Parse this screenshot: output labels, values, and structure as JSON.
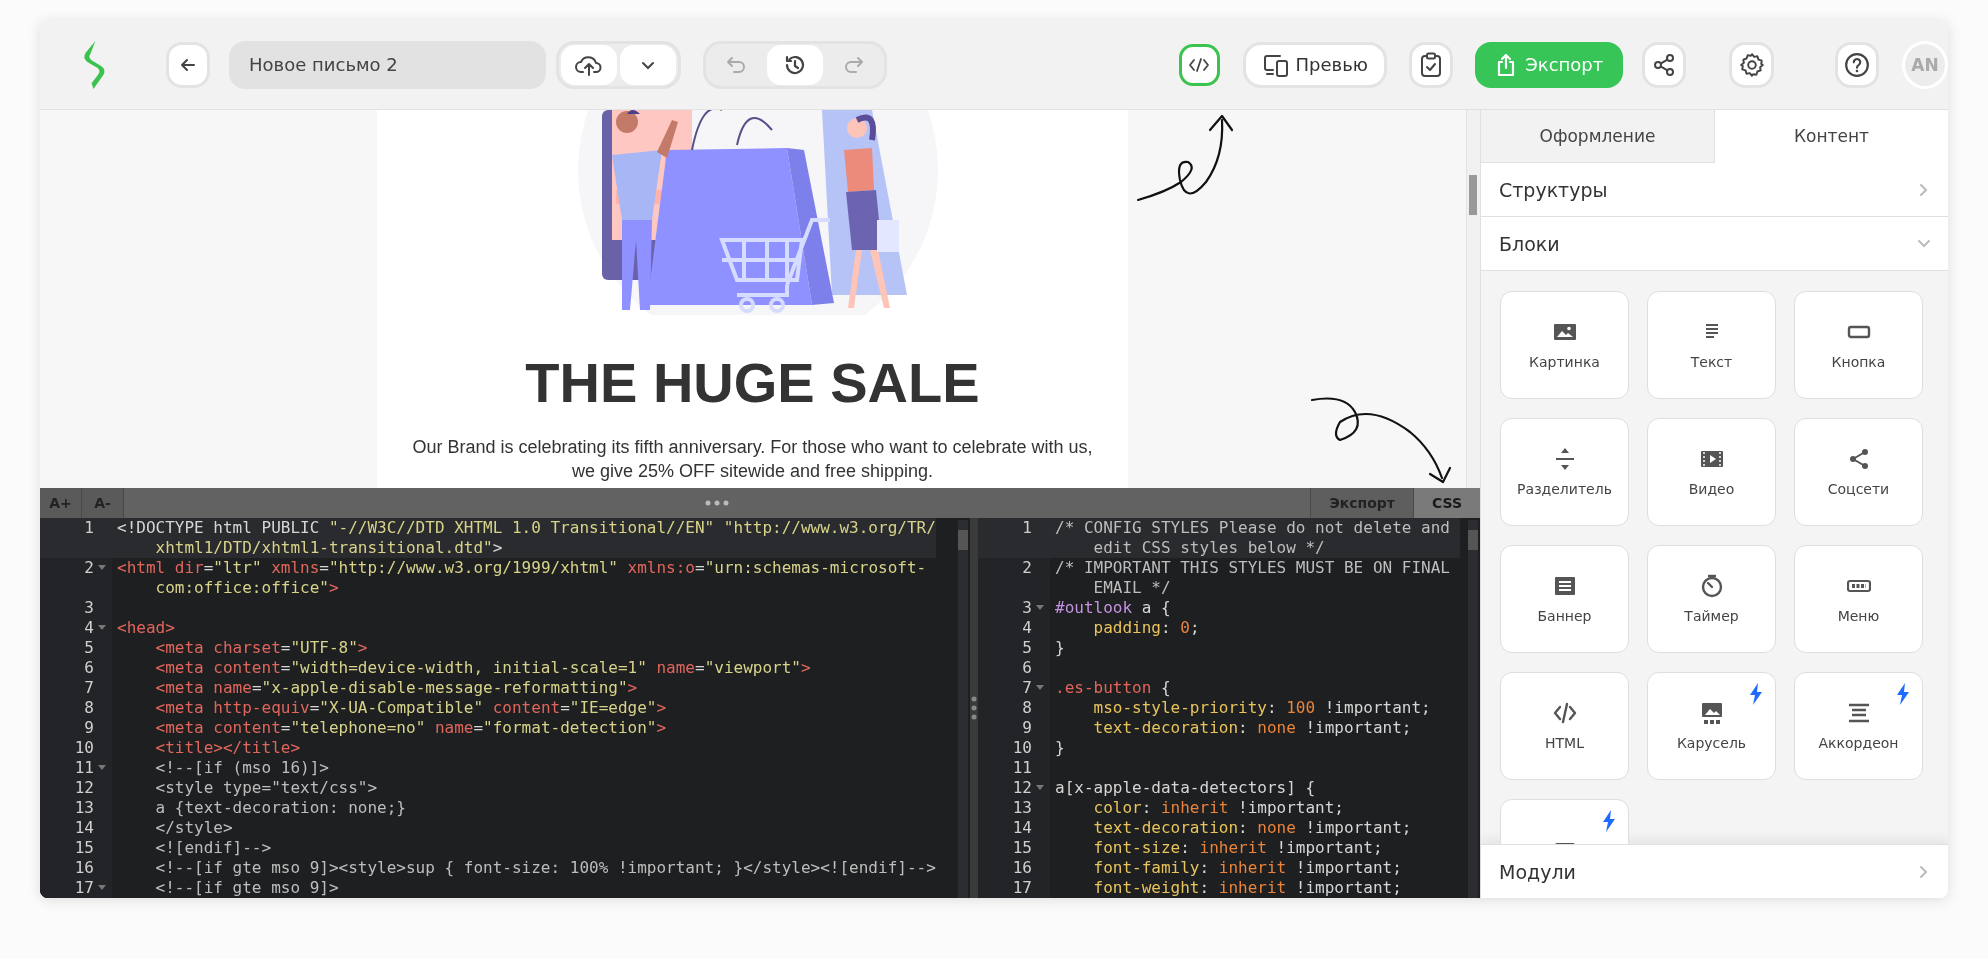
{
  "toolbar": {
    "title": "Новое письмо 2",
    "undo": {
      "disabled": true
    },
    "redo": {
      "disabled": true
    },
    "code_view": {
      "selected": true
    },
    "preview": "Превью",
    "export": "Экспорт",
    "avatar": "AN"
  },
  "canvas": {
    "heading": "THE HUGE SALE",
    "body": "Our Brand is celebrating its fifth anniversary. For those who want to celebrate with us, we give 25% OFF sitewide and free shipping."
  },
  "code_editor": {
    "font_buttons": [
      "A+",
      "A-"
    ],
    "tabs": [
      {
        "label": "Экспорт",
        "selected": false
      },
      {
        "label": "CSS",
        "selected": true
      }
    ],
    "html_lines": [
      {
        "n": "1",
        "fold": false,
        "active": true,
        "tokens": [
          {
            "kind": "plain",
            "t": "<!DOCTYPE html PUBLIC "
          },
          {
            "kind": "string",
            "t": "\"-//W3C//DTD XHTML 1.0 Transitional//EN\""
          },
          {
            "kind": "string",
            "t": " \"http://www.w3.org/TR/xhtml1/DTD/xhtml1-transitional.dtd\""
          },
          {
            "kind": "plain",
            "t": ">"
          }
        ]
      },
      {
        "n": "2",
        "fold": true,
        "active": false,
        "tokens": [
          {
            "kind": "tag",
            "t": "<html"
          },
          {
            "kind": "attr",
            "t": " dir"
          },
          {
            "kind": "plain",
            "t": "="
          },
          {
            "kind": "string",
            "t": "\"ltr\""
          },
          {
            "kind": "attr",
            "t": " xmlns"
          },
          {
            "kind": "plain",
            "t": "="
          },
          {
            "kind": "string",
            "t": "\"http://www.w3.org/1999/xhtml\""
          },
          {
            "kind": "attr",
            "t": " xmlns:o"
          },
          {
            "kind": "plain",
            "t": "="
          },
          {
            "kind": "string",
            "t": "\"urn:schemas-microsoft-com:office:office\""
          },
          {
            "kind": "tag",
            "t": ">"
          }
        ]
      },
      {
        "n": "3",
        "fold": false,
        "active": false
      },
      {
        "n": "4",
        "fold": true,
        "active": false,
        "tokens": [
          {
            "kind": "tag",
            "t": "<head>"
          }
        ]
      },
      {
        "n": "5",
        "fold": false,
        "active": false,
        "tokens": [
          {
            "kind": "tag",
            "t": "    <meta"
          },
          {
            "kind": "attr",
            "t": " charset"
          },
          {
            "kind": "plain",
            "t": "="
          },
          {
            "kind": "string",
            "t": "\"UTF-8\""
          },
          {
            "kind": "tag",
            "t": ">"
          }
        ]
      },
      {
        "n": "6",
        "fold": false,
        "active": false,
        "tokens": [
          {
            "kind": "tag",
            "t": "    <meta"
          },
          {
            "kind": "attr",
            "t": " content"
          },
          {
            "kind": "plain",
            "t": "="
          },
          {
            "kind": "string",
            "t": "\"width=device-width, initial-scale=1\""
          },
          {
            "kind": "attr",
            "t": " name"
          },
          {
            "kind": "plain",
            "t": "="
          },
          {
            "kind": "string",
            "t": "\"viewport\""
          },
          {
            "kind": "tag",
            "t": ">"
          }
        ]
      },
      {
        "n": "7",
        "fold": false,
        "active": false,
        "tokens": [
          {
            "kind": "tag",
            "t": "    <meta"
          },
          {
            "kind": "attr",
            "t": " name"
          },
          {
            "kind": "plain",
            "t": "="
          },
          {
            "kind": "string",
            "t": "\"x-apple-disable-message-reformatting\""
          },
          {
            "kind": "tag",
            "t": ">"
          }
        ]
      },
      {
        "n": "8",
        "fold": false,
        "active": false,
        "tokens": [
          {
            "kind": "tag",
            "t": "    <meta"
          },
          {
            "kind": "attr",
            "t": " http-equiv"
          },
          {
            "kind": "plain",
            "t": "="
          },
          {
            "kind": "string",
            "t": "\"X-UA-Compatible\""
          },
          {
            "kind": "attr",
            "t": " content"
          },
          {
            "kind": "plain",
            "t": "="
          },
          {
            "kind": "string",
            "t": "\"IE=edge\""
          },
          {
            "kind": "tag",
            "t": ">"
          }
        ]
      },
      {
        "n": "9",
        "fold": false,
        "active": false,
        "tokens": [
          {
            "kind": "tag",
            "t": "    <meta"
          },
          {
            "kind": "attr",
            "t": " content"
          },
          {
            "kind": "plain",
            "t": "="
          },
          {
            "kind": "string",
            "t": "\"telephone=no\""
          },
          {
            "kind": "attr",
            "t": " name"
          },
          {
            "kind": "plain",
            "t": "="
          },
          {
            "kind": "string",
            "t": "\"format-detection\""
          },
          {
            "kind": "tag",
            "t": ">"
          }
        ]
      },
      {
        "n": "10",
        "fold": false,
        "active": false,
        "tokens": [
          {
            "kind": "tag",
            "t": "    <title></title>"
          }
        ]
      },
      {
        "n": "11",
        "fold": true,
        "active": false,
        "tokens": [
          {
            "kind": "comment",
            "t": "    <!--[if (mso 16)]>"
          }
        ]
      },
      {
        "n": "12",
        "fold": false,
        "active": false,
        "tokens": [
          {
            "kind": "comment",
            "t": "    <style type=\"text/css\">"
          }
        ]
      },
      {
        "n": "13",
        "fold": false,
        "active": false,
        "tokens": [
          {
            "kind": "comment",
            "t": "    a {text-decoration: none;}"
          }
        ]
      },
      {
        "n": "14",
        "fold": false,
        "active": false,
        "tokens": [
          {
            "kind": "comment",
            "t": "    </style>"
          }
        ]
      },
      {
        "n": "15",
        "fold": false,
        "active": false,
        "tokens": [
          {
            "kind": "comment",
            "t": "    <![endif]-->"
          }
        ]
      },
      {
        "n": "16",
        "fold": false,
        "active": false,
        "tokens": [
          {
            "kind": "comment",
            "t": "    <!--[if gte mso 9]><style>sup { font-size: 100% !important; }</style><![endif]-->"
          }
        ]
      },
      {
        "n": "17",
        "fold": true,
        "active": false,
        "tokens": [
          {
            "kind": "comment",
            "t": "    <!--[if gte mso 9]>"
          }
        ]
      }
    ],
    "css_lines": [
      {
        "n": "1",
        "fold": false,
        "active": true,
        "tokens": [
          {
            "kind": "comment",
            "t": "/* CONFIG STYLES Please do not delete and edit CSS styles below */"
          }
        ]
      },
      {
        "n": "2",
        "fold": false,
        "active": false,
        "tokens": [
          {
            "kind": "comment",
            "t": "/* IMPORTANT THIS STYLES MUST BE ON FINAL EMAIL */"
          }
        ]
      },
      {
        "n": "3",
        "fold": true,
        "active": false,
        "tokens": [
          {
            "kind": "selector",
            "t": "#outlook"
          },
          {
            "kind": "plain",
            "t": " a {"
          }
        ]
      },
      {
        "n": "4",
        "fold": false,
        "active": false,
        "tokens": [
          {
            "kind": "property",
            "t": "    padding"
          },
          {
            "kind": "plain",
            "t": ": "
          },
          {
            "kind": "number",
            "t": "0"
          },
          {
            "kind": "plain",
            "t": ";"
          }
        ]
      },
      {
        "n": "5",
        "fold": false,
        "active": false,
        "tokens": [
          {
            "kind": "plain",
            "t": "}"
          }
        ]
      },
      {
        "n": "6",
        "fold": false,
        "active": false
      },
      {
        "n": "7",
        "fold": true,
        "active": false,
        "tokens": [
          {
            "kind": "class",
            "t": ".es-button"
          },
          {
            "kind": "plain",
            "t": " {"
          }
        ]
      },
      {
        "n": "8",
        "fold": false,
        "active": false,
        "tokens": [
          {
            "kind": "property",
            "t": "    mso-style-priority"
          },
          {
            "kind": "plain",
            "t": ": "
          },
          {
            "kind": "number",
            "t": "100"
          },
          {
            "kind": "plain",
            "t": " !important;"
          }
        ]
      },
      {
        "n": "9",
        "fold": false,
        "active": false,
        "tokens": [
          {
            "kind": "property",
            "t": "    text-decoration"
          },
          {
            "kind": "plain",
            "t": ": "
          },
          {
            "kind": "value",
            "t": "none"
          },
          {
            "kind": "plain",
            "t": " !important;"
          }
        ]
      },
      {
        "n": "10",
        "fold": false,
        "active": false,
        "tokens": [
          {
            "kind": "plain",
            "t": "}"
          }
        ]
      },
      {
        "n": "11",
        "fold": false,
        "active": false
      },
      {
        "n": "12",
        "fold": true,
        "active": false,
        "tokens": [
          {
            "kind": "plain",
            "t": "a[x-apple-data-detectors] {"
          }
        ]
      },
      {
        "n": "13",
        "fold": false,
        "active": false,
        "tokens": [
          {
            "kind": "property",
            "t": "    color"
          },
          {
            "kind": "plain",
            "t": ": "
          },
          {
            "kind": "value",
            "t": "inherit"
          },
          {
            "kind": "plain",
            "t": " !important;"
          }
        ]
      },
      {
        "n": "14",
        "fold": false,
        "active": false,
        "tokens": [
          {
            "kind": "property",
            "t": "    text-decoration"
          },
          {
            "kind": "plain",
            "t": ": "
          },
          {
            "kind": "value",
            "t": "none"
          },
          {
            "kind": "plain",
            "t": " !important;"
          }
        ]
      },
      {
        "n": "15",
        "fold": false,
        "active": false,
        "tokens": [
          {
            "kind": "property",
            "t": "    font-size"
          },
          {
            "kind": "plain",
            "t": ": "
          },
          {
            "kind": "value",
            "t": "inherit"
          },
          {
            "kind": "plain",
            "t": " !important;"
          }
        ]
      },
      {
        "n": "16",
        "fold": false,
        "active": false,
        "tokens": [
          {
            "kind": "property",
            "t": "    font-family"
          },
          {
            "kind": "plain",
            "t": ": "
          },
          {
            "kind": "value",
            "t": "inherit"
          },
          {
            "kind": "plain",
            "t": " !important;"
          }
        ]
      },
      {
        "n": "17",
        "fold": false,
        "active": false,
        "tokens": [
          {
            "kind": "property",
            "t": "    font-weight"
          },
          {
            "kind": "plain",
            "t": ": "
          },
          {
            "kind": "value",
            "t": "inherit"
          },
          {
            "kind": "plain",
            "t": " !important;"
          }
        ]
      }
    ]
  },
  "panel": {
    "tabs": [
      {
        "label": "Оформление",
        "selected": false
      },
      {
        "label": "Контент",
        "selected": true
      }
    ],
    "sections": [
      {
        "label": "Структуры",
        "expanded": false
      },
      {
        "label": "Блоки",
        "expanded": true
      }
    ],
    "blocks": [
      {
        "kind": "image",
        "label": "Картинка",
        "amp": false
      },
      {
        "kind": "text",
        "label": "Текст",
        "amp": false
      },
      {
        "kind": "button",
        "label": "Кнопка",
        "amp": false
      },
      {
        "kind": "divider",
        "label": "Разделитель",
        "amp": false
      },
      {
        "kind": "video",
        "label": "Видео",
        "amp": false
      },
      {
        "kind": "social",
        "label": "Соцсети",
        "amp": false
      },
      {
        "kind": "banner",
        "label": "Баннер",
        "amp": false
      },
      {
        "kind": "timer",
        "label": "Таймер",
        "amp": false
      },
      {
        "kind": "menu",
        "label": "Меню",
        "amp": false
      },
      {
        "kind": "html",
        "label": "HTML",
        "amp": false
      },
      {
        "kind": "carousel",
        "label": "Карусель",
        "amp": true
      },
      {
        "kind": "accordion",
        "label": "Аккордеон",
        "amp": true
      },
      {
        "kind": "form",
        "amp": true
      }
    ],
    "modules": {
      "label": "Модули",
      "expanded": false
    }
  }
}
